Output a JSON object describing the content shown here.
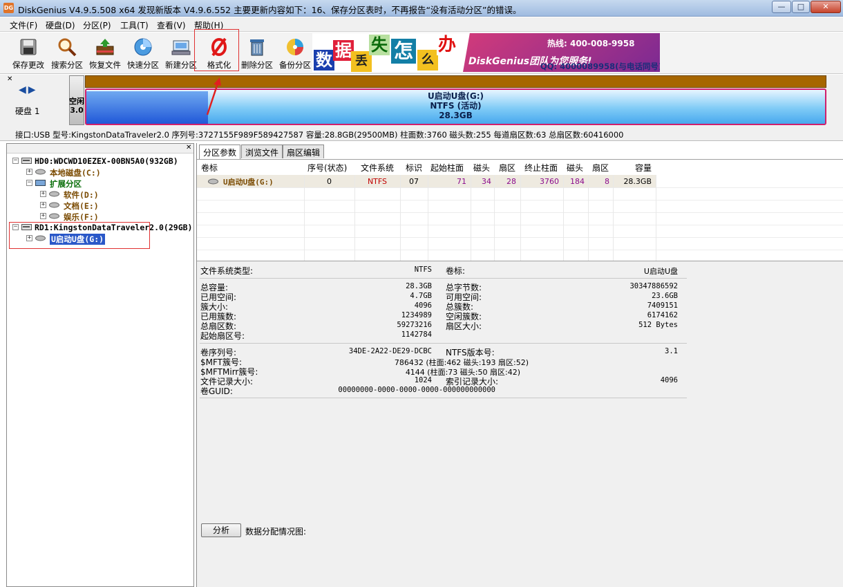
{
  "window": {
    "title": "DiskGenius V4.9.5.508 x64    发现新版本 V4.9.6.552 主要更新内容如下：16、保存分区表时，不再报告“没有活动分区”的错误。",
    "app_icon": "DG",
    "controls": {
      "minimize": "—",
      "maximize": "□",
      "close": "✕"
    }
  },
  "menu": [
    "文件(F)",
    "硬盘(D)",
    "分区(P)",
    "工具(T)",
    "查看(V)",
    "帮助(H)"
  ],
  "toolbar": [
    {
      "label": "保存更改",
      "icon": "save-disk-icon"
    },
    {
      "label": "搜索分区",
      "icon": "magnifier-icon"
    },
    {
      "label": "恢复文件",
      "icon": "recover-box-icon"
    },
    {
      "label": "快速分区",
      "icon": "quick-partition-icon"
    },
    {
      "label": "新建分区",
      "icon": "new-partition-icon"
    },
    {
      "label": "格式化",
      "icon": "format-icon"
    },
    {
      "label": "删除分区",
      "icon": "trash-icon"
    },
    {
      "label": "备份分区",
      "icon": "backup-disc-icon"
    }
  ],
  "banner": {
    "chars": [
      "数",
      "据",
      "丢",
      "失",
      "怎",
      "么",
      "办"
    ],
    "brand": "DiskGenius团队为您服务!",
    "phone": "热线: 400-008-9958",
    "qq": "QQ: 4000089958(与电话同号)"
  },
  "disk_map": {
    "disk_label": "硬盘 1",
    "free_label": "空闲\n3.0",
    "partition_name": "U启动U盘(G:)",
    "partition_fs": "NTFS (活动)",
    "partition_size": "28.3GB",
    "info": "接口:USB  型号:KingstonDataTraveler2.0  序列号:3727155F989F589427587  容量:28.8GB(29500MB)  柱面数:3760  磁头数:255  每道扇区数:63  总扇区数:60416000"
  },
  "tree": {
    "nodes": [
      {
        "label": "HD0:WDCWD10EZEX-00BN5A0(932GB)",
        "exp": "−",
        "color": "#000000"
      },
      {
        "label": "本地磁盘(C:)",
        "exp": "+",
        "color": "#7a4a00"
      },
      {
        "label": "扩展分区",
        "exp": "−",
        "color": "#0a6e0a"
      },
      {
        "label": "软件(D:)",
        "exp": "+",
        "color": "#7a4a00"
      },
      {
        "label": "文档(E:)",
        "exp": "+",
        "color": "#7a4a00"
      },
      {
        "label": "娱乐(F:)",
        "exp": "+",
        "color": "#7a4a00"
      },
      {
        "label": "RD1:KingstonDataTraveler2.0(29GB)",
        "exp": "−",
        "color": "#000000"
      },
      {
        "label": "U启动U盘(G:)",
        "exp": "+",
        "color": "#ffffff"
      }
    ]
  },
  "tabs": [
    "分区参数",
    "浏览文件",
    "扇区编辑"
  ],
  "table": {
    "columns": [
      "卷标",
      "序号(状态)",
      "文件系统",
      "标识",
      "起始柱面",
      "磁头",
      "扇区",
      "终止柱面",
      "磁头",
      "扇区",
      "容量"
    ],
    "row": {
      "name": "U启动U盘(G:)",
      "index": "0",
      "fs": "NTFS",
      "id": "07",
      "start_cyl": "71",
      "start_head": "34",
      "start_sector": "28",
      "end_cyl": "3760",
      "end_head": "184",
      "end_sector": "8",
      "size": "28.3GB"
    }
  },
  "info": {
    "fs_type_label": "文件系统类型:",
    "fs_type": "NTFS",
    "vol_label_label": "卷标:",
    "vol_label": "U启动U盘",
    "left_block": [
      {
        "label": "总容量:",
        "value": "28.3GB"
      },
      {
        "label": "已用空间:",
        "value": "4.7GB"
      },
      {
        "label": "簇大小:",
        "value": "4096"
      },
      {
        "label": "已用簇数:",
        "value": "1234989"
      },
      {
        "label": "总扇区数:",
        "value": "59273216"
      },
      {
        "label": "起始扇区号:",
        "value": "1142784"
      }
    ],
    "right_block": [
      {
        "label": "总字节数:",
        "value": "30347886592"
      },
      {
        "label": "可用空间:",
        "value": "23.6GB"
      },
      {
        "label": "总簇数:",
        "value": "7409151"
      },
      {
        "label": "空闲簇数:",
        "value": "6174162"
      },
      {
        "label": "扇区大小:",
        "value": "512 Bytes"
      }
    ],
    "serial_label": "卷序列号:",
    "serial": "34DE-2A22-DE29-DCBC",
    "ntfs_ver_label": "NTFS版本号:",
    "ntfs_ver": "3.1",
    "mft_label": "$MFT簇号:",
    "mft": "786432 (柱面:462 磁头:193 扇区:52)",
    "mftmirr_label": "$MFTMirr簇号:",
    "mftmirr": "4144 (柱面:73 磁头:50 扇区:42)",
    "record_size_label": "文件记录大小:",
    "record_size": "1024",
    "index_size_label": "索引记录大小:",
    "index_size": "4096",
    "guid_label": "卷GUID:",
    "guid": "00000000-0000-0000-0000-000000000000"
  },
  "analyze_button": "分析",
  "data_dist_label": "数据分配情况图:"
}
